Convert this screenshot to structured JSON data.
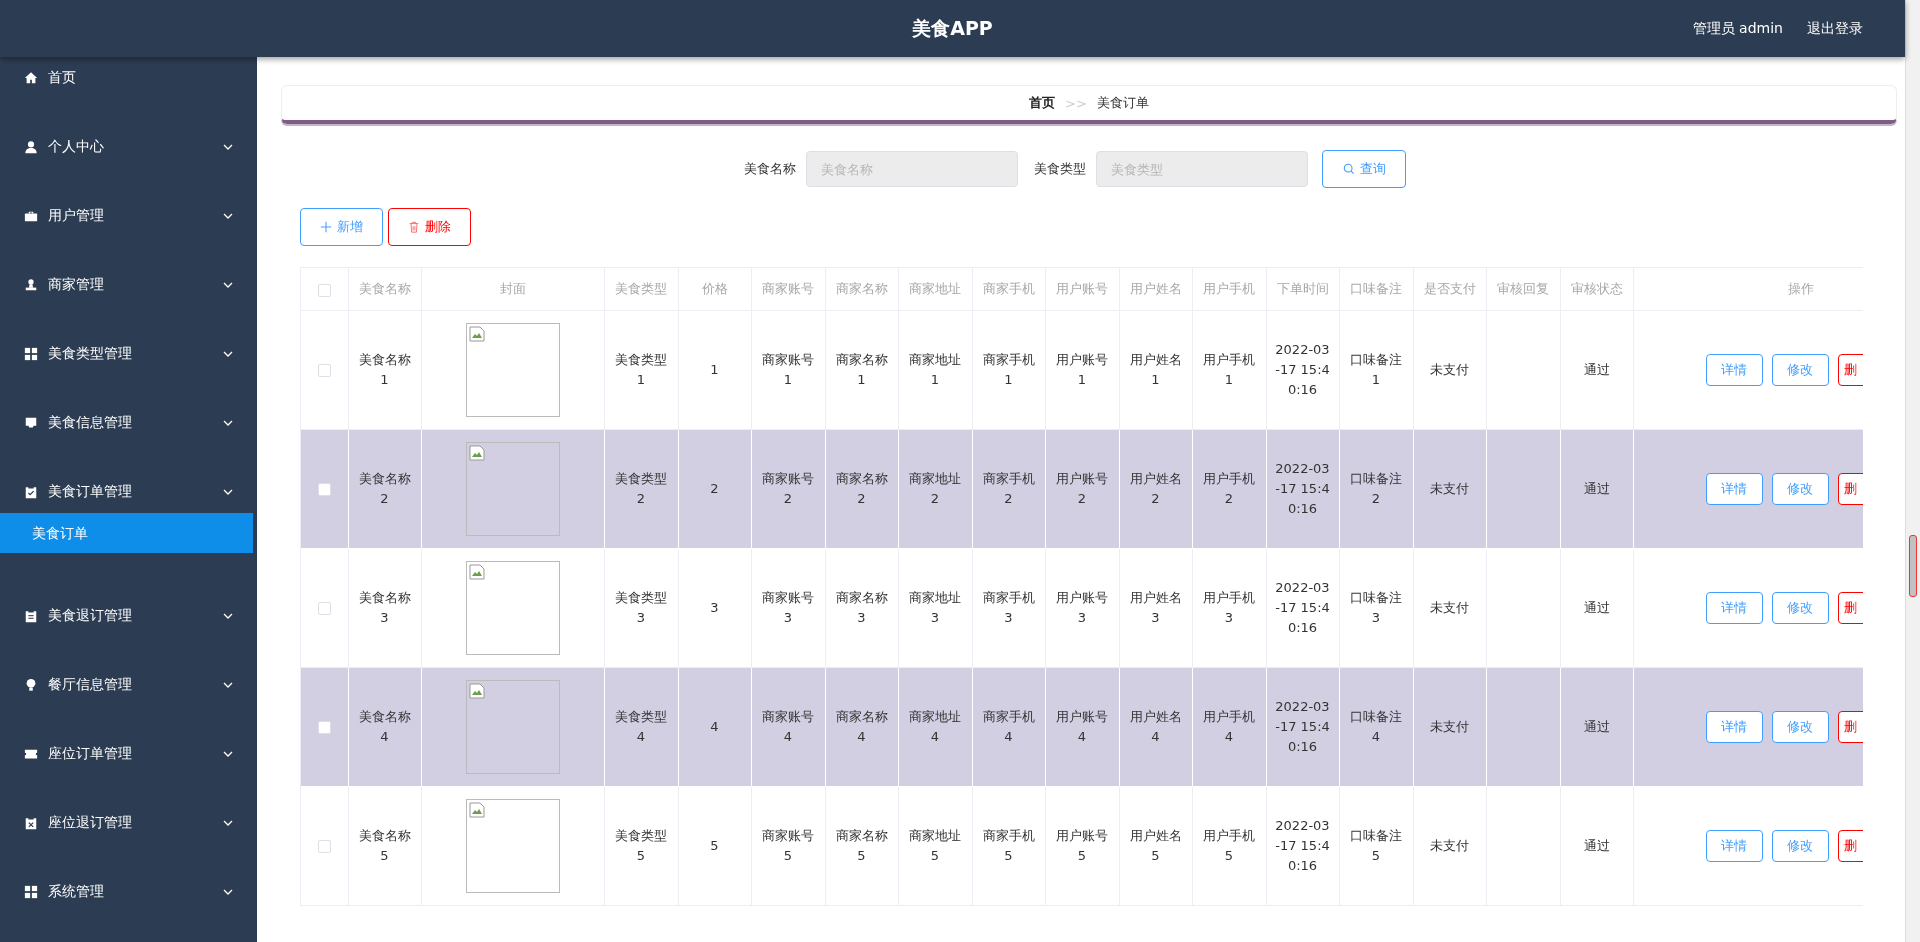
{
  "header": {
    "title": "美食APP",
    "user": "管理员 admin",
    "logout": "退出登录"
  },
  "sidebar": {
    "items": [
      {
        "label": "首页",
        "kind": "link"
      },
      {
        "label": "个人中心",
        "kind": "menu"
      },
      {
        "label": "用户管理",
        "kind": "menu"
      },
      {
        "label": "商家管理",
        "kind": "menu"
      },
      {
        "label": "美食类型管理",
        "kind": "menu"
      },
      {
        "label": "美食信息管理",
        "kind": "menu"
      },
      {
        "label": "美食订单管理",
        "kind": "menu",
        "expanded": true,
        "children": [
          {
            "label": "美食订单",
            "selected": true
          }
        ]
      },
      {
        "label": "美食退订管理",
        "kind": "menu"
      },
      {
        "label": "餐厅信息管理",
        "kind": "menu"
      },
      {
        "label": "座位订单管理",
        "kind": "menu"
      },
      {
        "label": "座位退订管理",
        "kind": "menu"
      },
      {
        "label": "系统管理",
        "kind": "menu"
      }
    ]
  },
  "breadcrumb": [
    "首页",
    ">>",
    "美食订单"
  ],
  "search": {
    "fields": [
      {
        "label": "美食名称",
        "placeholder": "美食名称"
      },
      {
        "label": "美食类型",
        "placeholder": "美食类型"
      }
    ],
    "button": "查询"
  },
  "toolbar": {
    "add": "新增",
    "delete": "删除"
  },
  "table": {
    "header_checked": false,
    "columns": [
      "美食名称",
      "封面",
      "美食类型",
      "价格",
      "商家账号",
      "商家名称",
      "商家地址",
      "商家手机",
      "用户账号",
      "用户姓名",
      "用户手机",
      "下单时间",
      "口味备注",
      "是否支付",
      "审核回复",
      "审核状态",
      "操作"
    ],
    "rows": [
      {
        "checked": false,
        "cells": [
          "美食名称1",
          "",
          "美食类型1",
          "1",
          "商家账号1",
          "商家名称1",
          "商家地址1",
          "商家手机1",
          "用户账号1",
          "用户姓名1",
          "用户手机1",
          "2022-03-17 15:40:16",
          "口味备注1",
          "未支付",
          "",
          "通过"
        ],
        "actions": [
          "详情",
          "修改",
          "删"
        ]
      },
      {
        "checked": false,
        "cells": [
          "美食名称2",
          "",
          "美食类型2",
          "2",
          "商家账号2",
          "商家名称2",
          "商家地址2",
          "商家手机2",
          "用户账号2",
          "用户姓名2",
          "用户手机2",
          "2022-03-17 15:40:16",
          "口味备注2",
          "未支付",
          "",
          "通过"
        ],
        "actions": [
          "详情",
          "修改",
          "删"
        ]
      },
      {
        "checked": false,
        "cells": [
          "美食名称3",
          "",
          "美食类型3",
          "3",
          "商家账号3",
          "商家名称3",
          "商家地址3",
          "商家手机3",
          "用户账号3",
          "用户姓名3",
          "用户手机3",
          "2022-03-17 15:40:16",
          "口味备注3",
          "未支付",
          "",
          "通过"
        ],
        "actions": [
          "详情",
          "修改",
          "删"
        ]
      },
      {
        "checked": false,
        "cells": [
          "美食名称4",
          "",
          "美食类型4",
          "4",
          "商家账号4",
          "商家名称4",
          "商家地址4",
          "商家手机4",
          "用户账号4",
          "用户姓名4",
          "用户手机4",
          "2022-03-17 15:40:16",
          "口味备注4",
          "未支付",
          "",
          "通过"
        ],
        "actions": [
          "详情",
          "修改",
          "删"
        ]
      },
      {
        "checked": false,
        "cells": [
          "美食名称5",
          "",
          "美食类型5",
          "5",
          "商家账号5",
          "商家名称5",
          "商家地址5",
          "商家手机5",
          "用户账号5",
          "用户姓名5",
          "用户手机5",
          "2022-03-17 15:40:16",
          "口味备注5",
          "未支付",
          "",
          "通过"
        ],
        "actions": [
          "详情",
          "修改",
          "删"
        ]
      }
    ]
  }
}
